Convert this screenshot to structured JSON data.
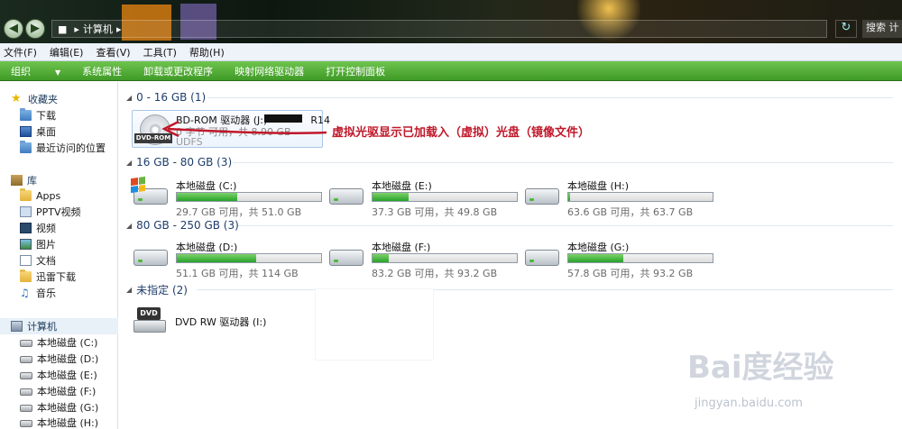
{
  "address": {
    "crumb": "计算机",
    "sep": "▸",
    "search_text": "搜索 计"
  },
  "menu": [
    "文件(F)",
    "编辑(E)",
    "查看(V)",
    "工具(T)",
    "帮助(H)"
  ],
  "commands": {
    "organize": "组织",
    "items": [
      "系统属性",
      "卸载或更改程序",
      "映射网络驱动器",
      "打开控制面板"
    ]
  },
  "sidebar": {
    "favorites_label": "收藏夹",
    "favorites": [
      "下载",
      "桌面",
      "最近访问的位置"
    ],
    "libraries_label": "库",
    "libraries": [
      "Apps",
      "PPTV视频",
      "视频",
      "图片",
      "文档",
      "迅雷下载",
      "音乐"
    ],
    "computer_label": "计算机",
    "drives": [
      "本地磁盘 (C:)",
      "本地磁盘 (D:)",
      "本地磁盘 (E:)",
      "本地磁盘 (F:)",
      "本地磁盘 (G:)",
      "本地磁盘 (H:)"
    ]
  },
  "groups": [
    "0 - 16 GB (1)",
    "16 GB - 80 GB (3)",
    "80 GB - 250 GB (3)",
    "未指定 (2)"
  ],
  "virtual_drive": {
    "name": "BD-ROM 驱动器 (J:)",
    "name_tail": "R14",
    "free": "0 字节 可用，共 8.90 GB",
    "fs": "UDFS",
    "tag": "DVD-ROM"
  },
  "annotation": "虚拟光驱显示已加载入（虚拟）光盘（镜像文件）",
  "drives": [
    {
      "name": "本地磁盘 (C:)",
      "free": "29.7 GB 可用，共 51.0 GB",
      "used_fraction": 0.42
    },
    {
      "name": "本地磁盘 (E:)",
      "free": "37.3 GB 可用，共 49.8 GB",
      "used_fraction": 0.25
    },
    {
      "name": "本地磁盘 (H:)",
      "free": "63.6 GB 可用，共 63.7 GB",
      "used_fraction": 0.01
    },
    {
      "name": "本地磁盘 (D:)",
      "free": "51.1 GB 可用，共 114 GB",
      "used_fraction": 0.55
    },
    {
      "name": "本地磁盘 (F:)",
      "free": "83.2 GB 可用，共 93.2 GB",
      "used_fraction": 0.11
    },
    {
      "name": "本地磁盘 (G:)",
      "free": "57.8 GB 可用，共 93.2 GB",
      "used_fraction": 0.38
    }
  ],
  "dvd_rw": {
    "name": "DVD RW 驱动器 (I:)",
    "tag": "DVD"
  },
  "watermark": {
    "brand": "Bai度经验",
    "url": "jingyan.baidu.com"
  },
  "colors": {
    "accent_green": "#3e9a26",
    "annotation_red": "#c0182a",
    "bar_fill": "#27a32a"
  }
}
